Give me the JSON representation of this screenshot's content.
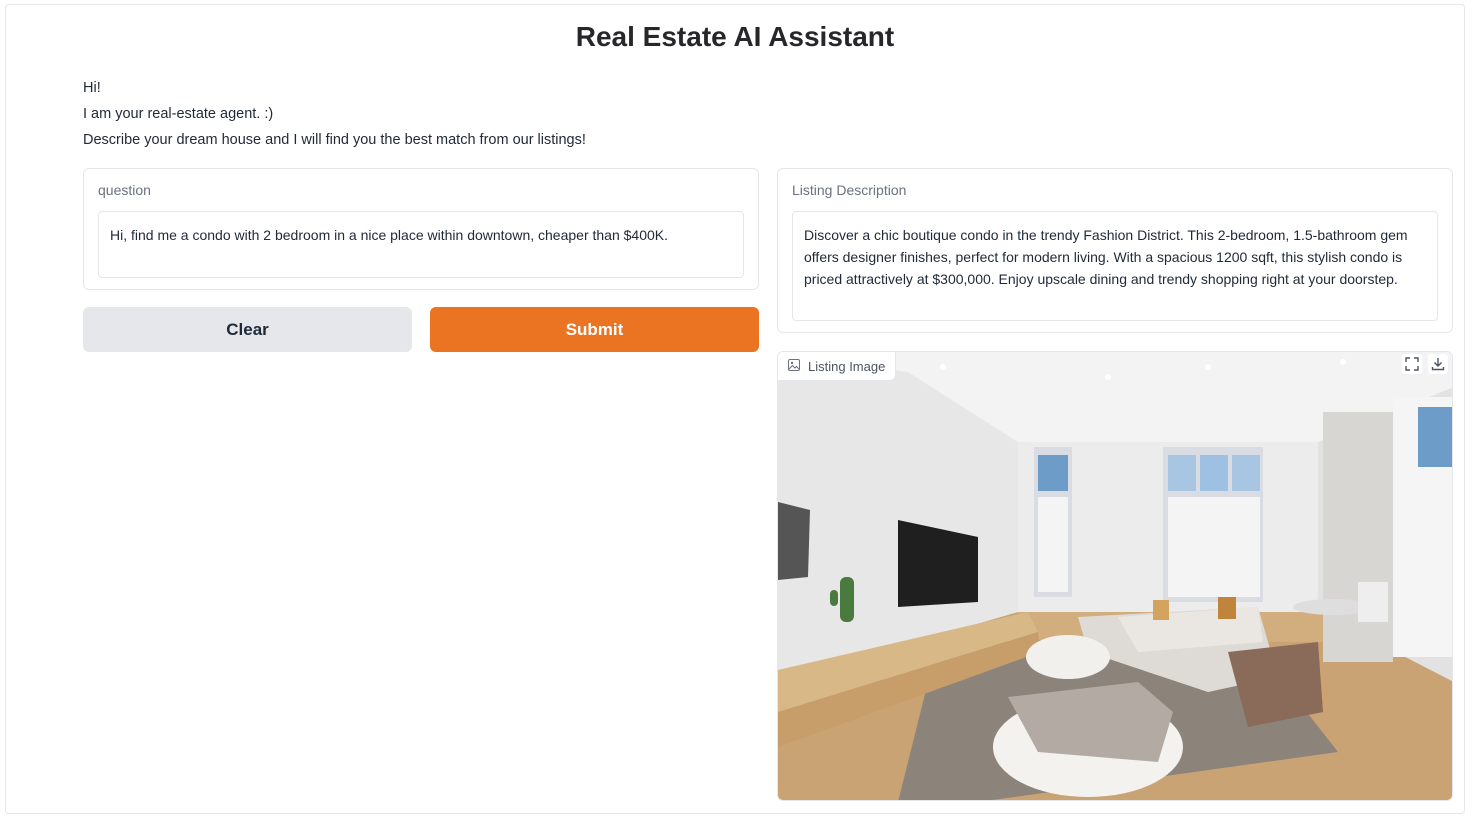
{
  "app": {
    "title": "Real Estate AI Assistant"
  },
  "intro": {
    "line1": "Hi!",
    "line2": "I am your real-estate agent. :)",
    "line3": "Describe your dream house and I will find you the best match from our listings!"
  },
  "question": {
    "label": "question",
    "value": "Hi, find me a condo with 2 bedroom in a nice place within downtown, cheaper than $400K."
  },
  "buttons": {
    "clear_label": "Clear",
    "submit_label": "Submit"
  },
  "listing": {
    "description_label": "Listing Description",
    "description": "Discover a chic boutique condo in the trendy Fashion District. This 2-bedroom, 1.5-bathroom gem offers designer finishes, perfect for modern living. With a spacious 1200 sqft, this stylish condo is priced attractively at $300,000. Enjoy upscale dining and trendy shopping right at your doorstep.",
    "image_label": "Listing Image",
    "image_icon": "image-icon",
    "fullscreen_icon": "fullscreen-icon",
    "download_icon": "download-icon"
  },
  "colors": {
    "accent": "#ea7421",
    "secondary_button": "#e5e7eb",
    "border": "#e5e7eb",
    "label_text": "#6b7280"
  }
}
